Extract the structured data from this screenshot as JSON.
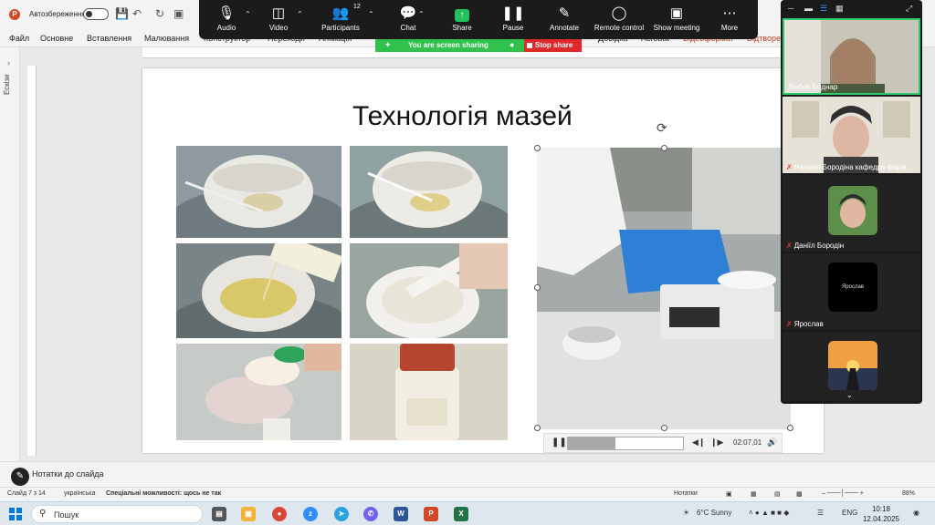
{
  "titlebar": {
    "autosave_label": "Автозбереження"
  },
  "ribbon": {
    "tabs": [
      "Файл",
      "Основне",
      "Вставлення",
      "Малювання",
      "Конструктор",
      "Переходи",
      "Анімація",
      "Довідка",
      "Acrobat",
      "Відеоформат",
      "Відтворе"
    ]
  },
  "zoom_toolbar": {
    "audio": "Audio",
    "video": "Video",
    "participants": "Participants",
    "participants_count": "12",
    "chat": "Chat",
    "share": "Share",
    "pause": "Pause",
    "annotate": "Annotate",
    "remote_control": "Remote control",
    "show_meeting": "Show meeting",
    "more": "More"
  },
  "sharing_banner": {
    "text": "You are screen sharing",
    "stop_label": "Stop share"
  },
  "left_panel": {
    "label": "Ескізи"
  },
  "slide": {
    "title": "Технологія мазей"
  },
  "video_player": {
    "time": "02:07,01",
    "progress": 0.41
  },
  "participants": [
    {
      "name": "Любов Боднар",
      "muted": false
    },
    {
      "name": "Наталія Бородіна кафедра фарм...",
      "muted": true
    },
    {
      "name": "Даніїл Бородін",
      "muted": true
    },
    {
      "name": "Ярослав",
      "muted": true,
      "avatar_text": "Ярослав"
    }
  ],
  "notes": {
    "label": "Нотатки до слайда"
  },
  "statusbar": {
    "slide_info": "Слайд 7 з 14",
    "language": "українська",
    "accessibility": "Спеціальні можливості: щось не так",
    "notes_btn": "Нотатки",
    "zoom": "88%"
  },
  "taskbar": {
    "search_placeholder": "Пошук",
    "weather": "6°C  Sunny",
    "lang": "ENG",
    "time": "10:18",
    "date": "12.04.2025"
  }
}
